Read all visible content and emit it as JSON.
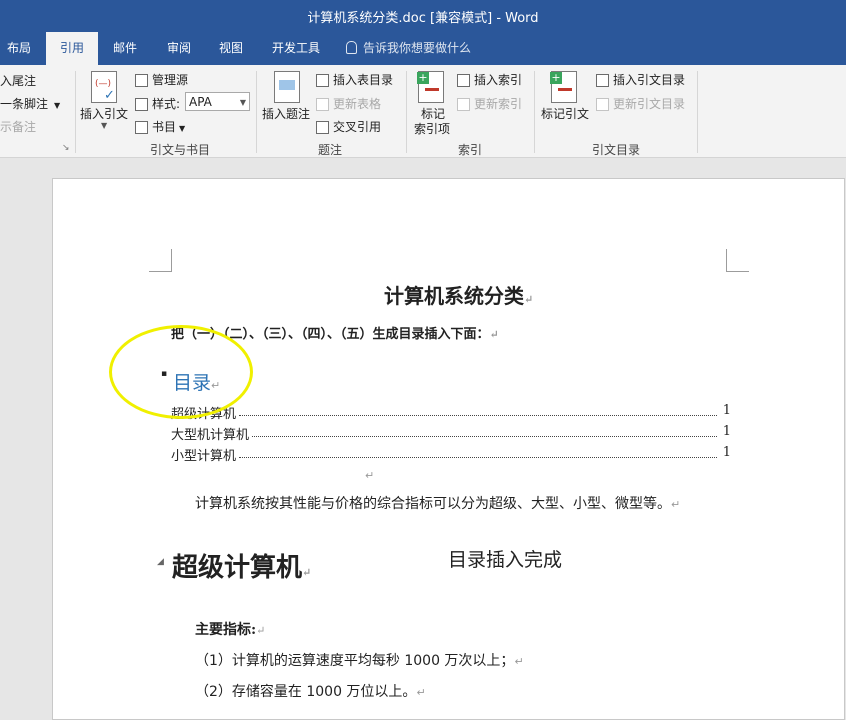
{
  "window": {
    "title": "计算机系统分类.doc [兼容模式] - Word"
  },
  "tabs": [
    {
      "label": "布局"
    },
    {
      "label": "引用"
    },
    {
      "label": "邮件"
    },
    {
      "label": "审阅"
    },
    {
      "label": "视图"
    },
    {
      "label": "开发工具"
    }
  ],
  "tell_me": "告诉我你想要做什么",
  "ribbon": {
    "footnotes": {
      "insert_endnote": "入尾注",
      "next_footnote": "一条脚注",
      "show_notes": "示备注"
    },
    "citations": {
      "insert_citation": "插入引文",
      "manage_sources": "管理源",
      "style_label": "样式:",
      "style_value": "APA",
      "bibliography": "书目",
      "group_label": "引文与书目"
    },
    "captions": {
      "insert_caption": "插入题注",
      "insert_table_of_figures": "插入表目录",
      "update_table": "更新表格",
      "cross_reference": "交叉引用",
      "group_label": "题注"
    },
    "index": {
      "mark_entry_line1": "标记",
      "mark_entry_line2": "索引项",
      "insert_index": "插入索引",
      "update_index": "更新索引",
      "group_label": "索引"
    },
    "authorities": {
      "mark_citation": "标记引文",
      "insert_table_of_authorities": "插入引文目录",
      "update_table": "更新引文目录",
      "group_label": "引文目录"
    }
  },
  "document": {
    "title": "计算机系统分类",
    "instruction": "把（一）（二）、（三）、（四）、（五）生成目录插入下面：",
    "toc_heading": "目录",
    "toc": [
      {
        "name": "超级计算机",
        "page": "1"
      },
      {
        "name": "大型机计算机",
        "page": "1"
      },
      {
        "name": "小型计算机",
        "page": "1"
      }
    ],
    "intro": "计算机系统按其性能与价格的综合指标可以分为超级、大型、小型、微型等。",
    "heading1": "超级计算机",
    "overlay_note": "目录插入完成",
    "main_indicator": "主要指标:",
    "items": [
      "（1）计算机的运算速度平均每秒 1000 万次以上；",
      "（2）存储容量在 1000 万位以上。"
    ],
    "para_mark": "↵"
  },
  "colors": {
    "accent": "#2b579a",
    "toc_heading": "#2e74b5",
    "annotation": "#f0f000"
  }
}
